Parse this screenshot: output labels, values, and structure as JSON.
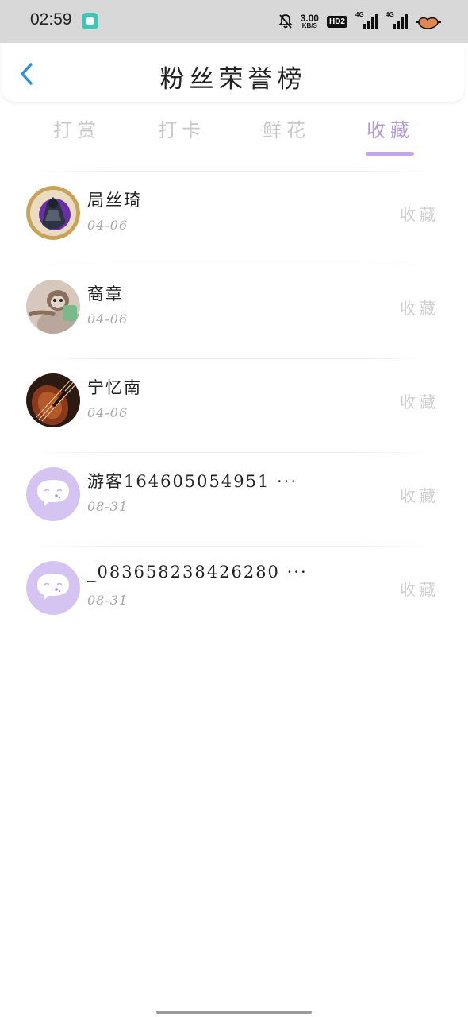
{
  "status_bar": {
    "time": "02:59",
    "net_speed_value": "3.00",
    "net_speed_unit": "KB/S",
    "hd_label": "HD2",
    "signal1_label": "4G",
    "signal2_label": "4G"
  },
  "header": {
    "title": "粉丝荣誉榜"
  },
  "tabs": [
    {
      "label": "打赏",
      "active": false
    },
    {
      "label": "打卡",
      "active": false
    },
    {
      "label": "鲜花",
      "active": false
    },
    {
      "label": "收藏",
      "active": true
    }
  ],
  "fans": [
    {
      "name": "局丝琦",
      "date": "04-06",
      "action": "收藏",
      "avatar": "knight-avatar-icon"
    },
    {
      "name": "裔章",
      "date": "04-06",
      "action": "收藏",
      "avatar": "sloth-avatar-icon"
    },
    {
      "name": "宁忆南",
      "date": "04-06",
      "action": "收藏",
      "avatar": "violin-avatar-icon"
    },
    {
      "name": "游客164605054951 ···",
      "date": "08-31",
      "action": "收藏",
      "avatar": "default-chat-avatar-icon"
    },
    {
      "name": "_083658238426280 ···",
      "date": "08-31",
      "action": "收藏",
      "avatar": "default-chat-avatar-icon"
    }
  ],
  "colors": {
    "accent": "#b59ad9",
    "underline": "#c2a7e6",
    "back_arrow": "#2d8fe0",
    "status_bar_bg": "#d8d8d8"
  }
}
